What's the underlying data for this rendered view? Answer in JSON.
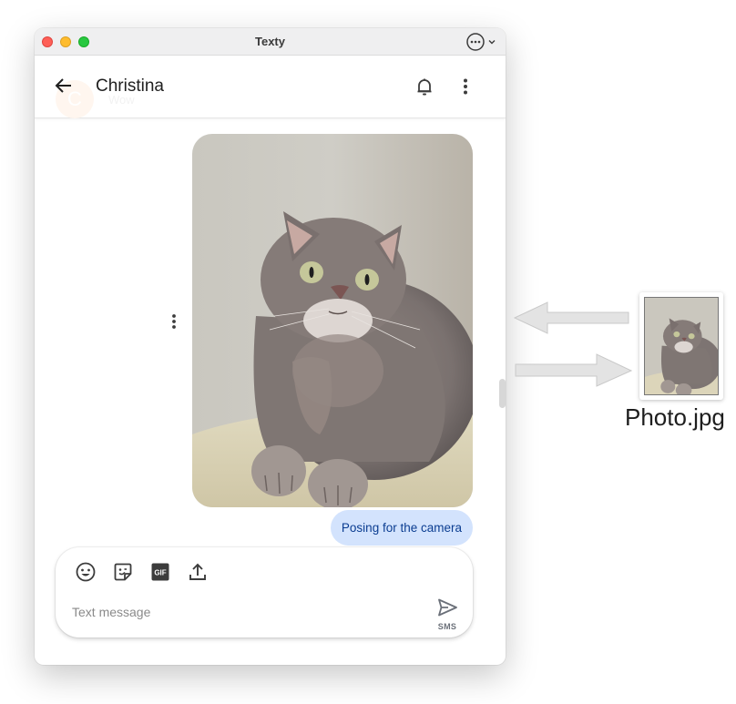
{
  "window": {
    "title": "Texty",
    "traffic_lights": {
      "close": "#fe5f57",
      "minimize": "#febc2e",
      "zoom": "#28c840"
    },
    "more_menu_icon": "ellipsis-circle-icon"
  },
  "header": {
    "back_icon": "arrow-left-icon",
    "contact_name": "Christina",
    "ghost_avatar_letter": "C",
    "ghost_preview": "Wow",
    "notification_icon": "bell-icon",
    "menu_icon": "more-vertical-icon"
  },
  "conversation": {
    "messages": [
      {
        "type": "image",
        "subject": "Gray tabby cat lying on a cushion looking up",
        "options_icon": "more-vertical-icon"
      },
      {
        "type": "text",
        "text": "Posing for the camera",
        "bubble_color": "#d3e3fd",
        "text_color": "#0b3d91"
      }
    ]
  },
  "composer": {
    "tools": [
      {
        "name": "emoji",
        "icon": "emoji-icon"
      },
      {
        "name": "sticker",
        "icon": "sticker-icon"
      },
      {
        "name": "gif",
        "icon": "gif-icon",
        "label": "GIF"
      },
      {
        "name": "upload",
        "icon": "upload-icon"
      }
    ],
    "input_value": "",
    "input_placeholder": "Text message",
    "send_icon": "send-icon",
    "send_label": "SMS"
  },
  "drag_file": {
    "file_name": "Photo.jpg",
    "arrows": [
      "arrow-left-icon",
      "arrow-right-icon"
    ]
  }
}
